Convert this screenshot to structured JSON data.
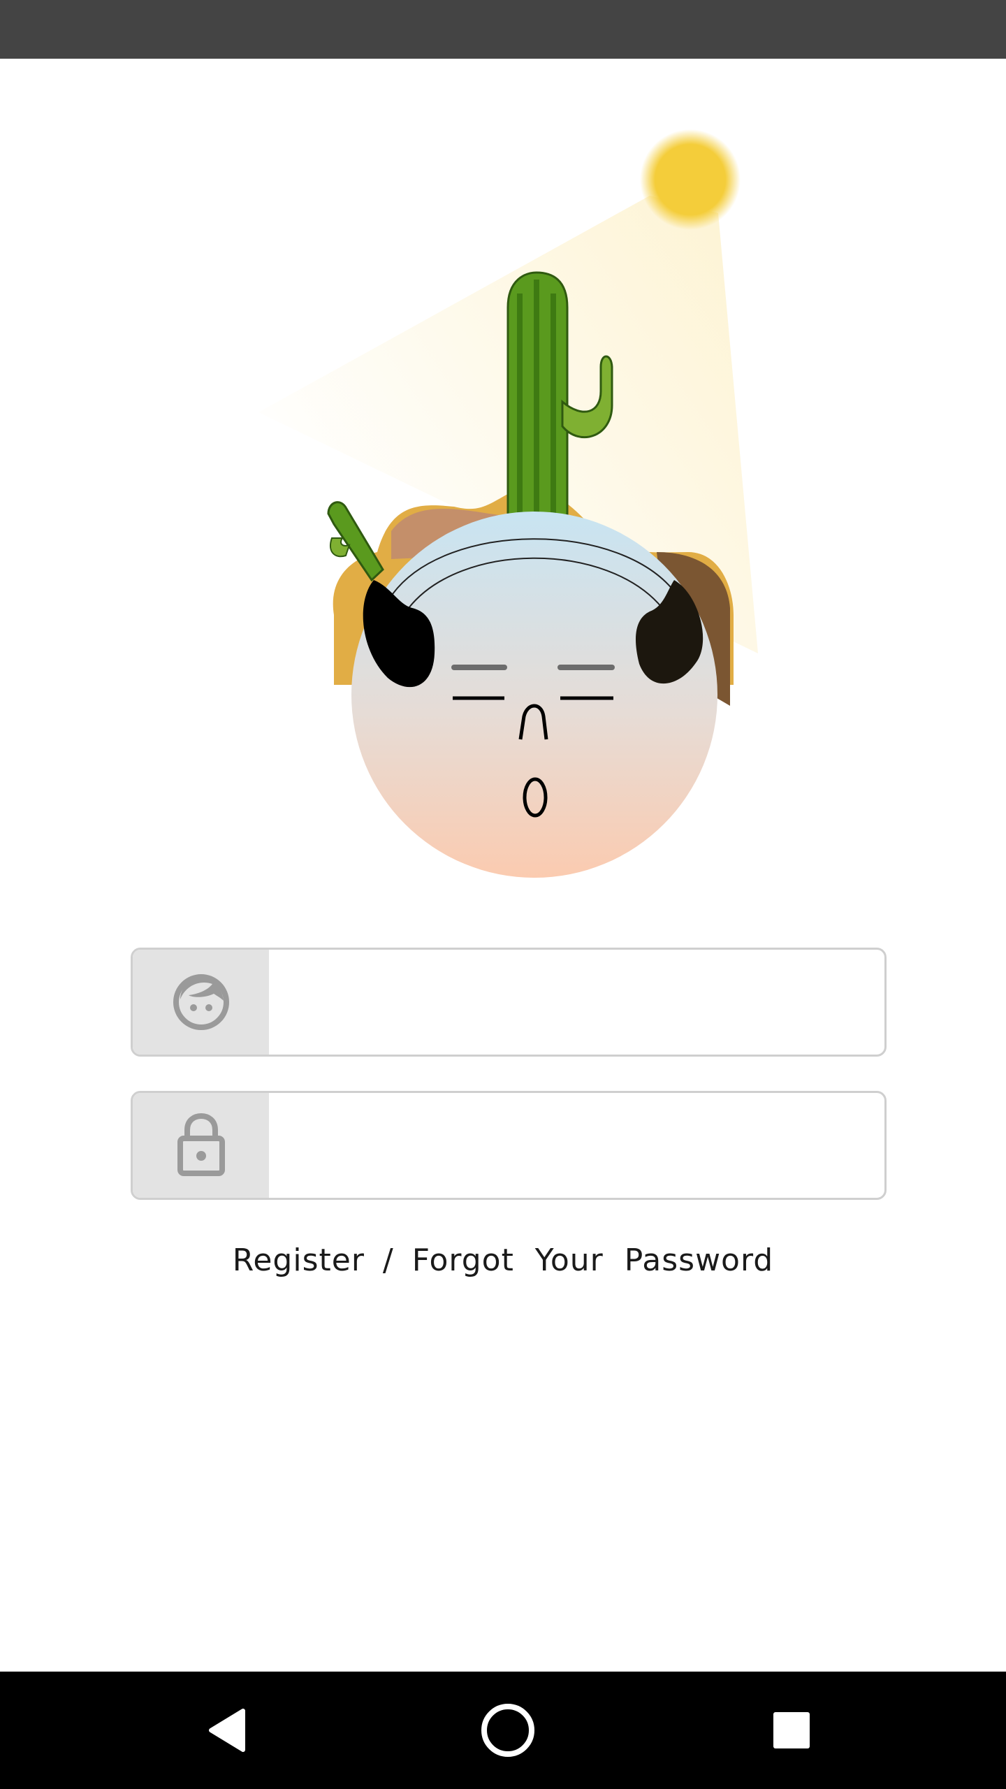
{
  "login": {
    "username": {
      "value": "",
      "placeholder": "",
      "icon": "face-icon"
    },
    "password": {
      "value": "",
      "placeholder": "",
      "icon": "lock-icon"
    }
  },
  "links": {
    "register": "Register",
    "separator": "/",
    "forgot": "Forgot  Your  Password"
  },
  "nav": {
    "back_icon": "back-triangle-icon",
    "home_icon": "home-circle-icon",
    "recents_icon": "recents-square-icon"
  },
  "colors": {
    "status_bar": "#444444",
    "nav_bar": "#000000",
    "field_icon_bg": "#e3e3e3",
    "sun": "#f4cd3a",
    "cactus": "#5a9a1e"
  }
}
